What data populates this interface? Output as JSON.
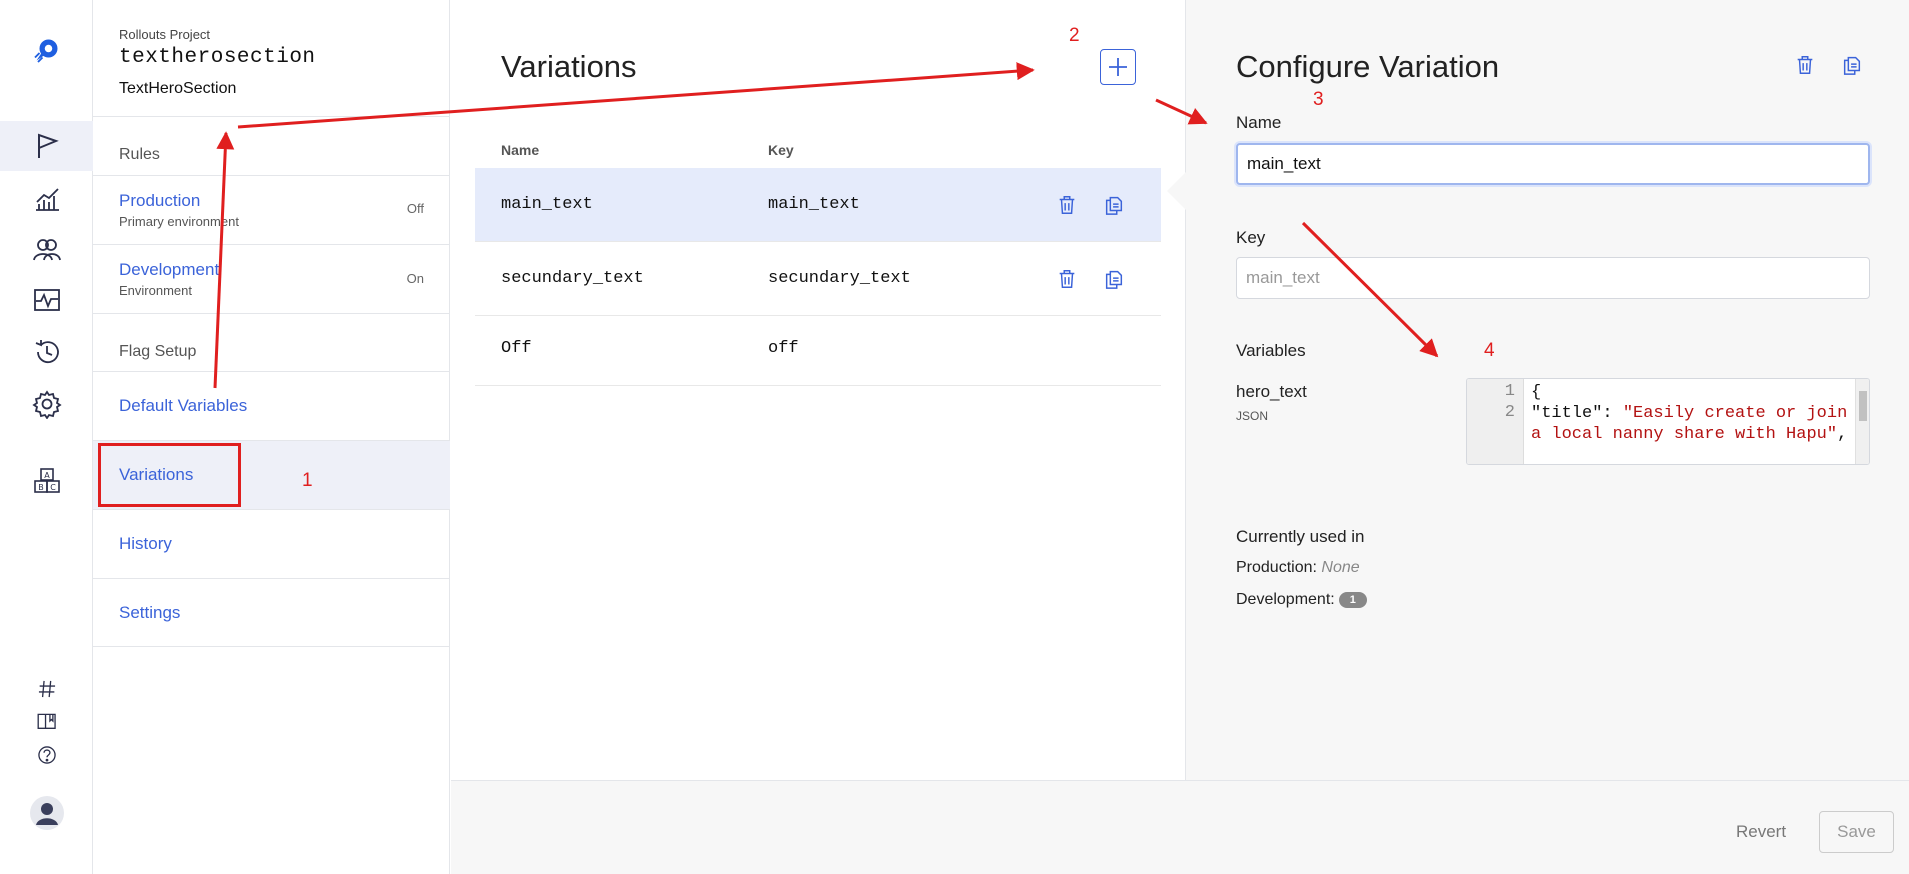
{
  "sidebar": {
    "project_label": "Rollouts Project",
    "flag_key": "textherosection",
    "flag_name": "TextHeroSection",
    "rules_title": "Rules",
    "environments": [
      {
        "name": "Production",
        "description": "Primary environment",
        "state": "Off"
      },
      {
        "name": "Development",
        "description": "Environment",
        "state": "On"
      }
    ],
    "flag_setup_title": "Flag Setup",
    "nav": [
      {
        "label": "Default Variables"
      },
      {
        "label": "Variations"
      },
      {
        "label": "History"
      },
      {
        "label": "Settings"
      }
    ]
  },
  "variations": {
    "title": "Variations",
    "columns": {
      "name": "Name",
      "key": "Key"
    },
    "rows": [
      {
        "name": "main_text",
        "key": "main_text"
      },
      {
        "name": "secundary_text",
        "key": "secundary_text"
      },
      {
        "name": "Off",
        "key": "off"
      }
    ]
  },
  "configure": {
    "title": "Configure Variation",
    "name_label": "Name",
    "name_value": "main_text",
    "key_label": "Key",
    "key_value": "main_text",
    "variables_label": "Variables",
    "variable": {
      "name": "hero_text",
      "type": "JSON",
      "line_numbers": [
        "1",
        "2"
      ],
      "code_line1": "{",
      "code_key": "\"title\"",
      "code_sep": ": ",
      "code_value": "\"Easily create or join a local nanny share with Hapu\"",
      "code_end": ","
    },
    "used_title": "Currently used in",
    "used": [
      {
        "env": "Production:",
        "value": "None"
      },
      {
        "env": "Development:",
        "count": "1"
      }
    ]
  },
  "footer": {
    "revert_label": "Revert",
    "save_label": "Save"
  },
  "annotations": [
    "1",
    "2",
    "3",
    "4"
  ],
  "colors": {
    "accent": "#3b63d9",
    "selected_row": "#e5ebfb",
    "annotation": "#e01f1f"
  },
  "icons": {
    "rail": [
      "logo-icon",
      "flag-icon",
      "chart-icon",
      "users-icon",
      "activity-icon",
      "history-icon",
      "gear-icon",
      "blocks-icon",
      "hash-icon",
      "book-icon",
      "help-icon",
      "avatar"
    ]
  }
}
